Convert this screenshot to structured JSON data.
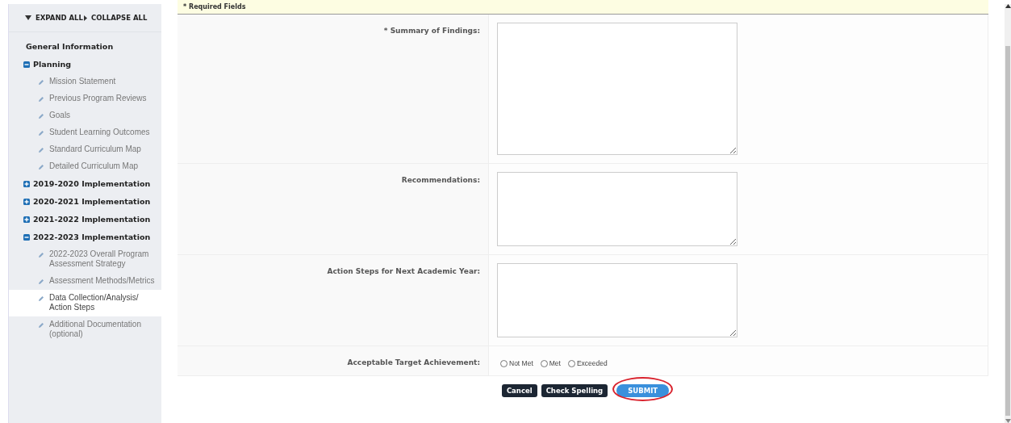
{
  "sidebar": {
    "expand_all": "EXPAND ALL",
    "collapse_all": "COLLAPSE ALL",
    "sections": [
      {
        "label": "General Information",
        "kind": "plain"
      },
      {
        "label": "Planning",
        "kind": "group",
        "expanded": true,
        "children": [
          {
            "label": "Mission Statement",
            "selected": false
          },
          {
            "label": "Previous Program Reviews",
            "selected": false
          },
          {
            "label": "Goals",
            "selected": false
          },
          {
            "label": "Student Learning Outcomes",
            "selected": false
          },
          {
            "label": "Standard Curriculum Map",
            "selected": false
          },
          {
            "label": "Detailed Curriculum Map",
            "selected": false
          }
        ]
      },
      {
        "label": "2019-2020 Implementation",
        "kind": "group",
        "expanded": false
      },
      {
        "label": "2020-2021 Implementation",
        "kind": "group",
        "expanded": false
      },
      {
        "label": "2021-2022 Implementation",
        "kind": "group",
        "expanded": false
      },
      {
        "label": "2022-2023 Implementation",
        "kind": "group",
        "expanded": true,
        "children": [
          {
            "label": "2022-2023 Overall Program Assessment Strategy",
            "selected": false
          },
          {
            "label": "Assessment Methods/Metrics",
            "selected": false
          },
          {
            "label": "Data Collection/Analysis/ Action Steps",
            "selected": true
          },
          {
            "label": "Additional Documentation (optional)",
            "selected": false
          }
        ]
      }
    ]
  },
  "form": {
    "required_note": "* Required Fields",
    "fields": [
      {
        "label": "* Summary of Findings:",
        "kind": "tall_textarea"
      },
      {
        "label": "Recommendations:",
        "kind": "textarea"
      },
      {
        "label": "Action Steps for Next Academic Year:",
        "kind": "textarea"
      },
      {
        "label": "Acceptable Target Achievement:",
        "kind": "radio",
        "options": [
          {
            "label": "Not Met",
            "selected": false
          },
          {
            "label": "Met",
            "selected": false
          },
          {
            "label": "Exceeded",
            "selected": false
          }
        ]
      }
    ]
  },
  "buttons": [
    {
      "label": "Cancel",
      "kind": "dark",
      "highlighted": false
    },
    {
      "label": "Check Spelling",
      "kind": "dark",
      "highlighted": false
    },
    {
      "label": "SUBMIT",
      "kind": "primary",
      "highlighted": true
    }
  ]
}
